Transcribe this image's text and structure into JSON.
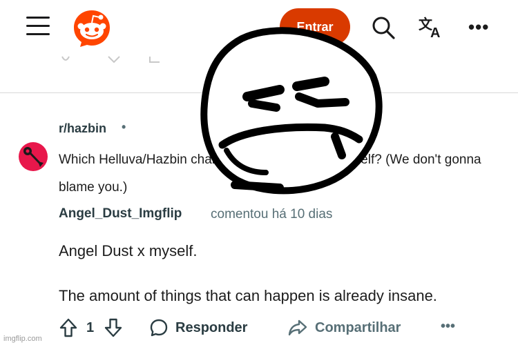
{
  "header": {
    "enter_label": "Entrar",
    "colors": {
      "brand": "#ff4500",
      "enter_button": "#d93a00"
    },
    "icons": [
      "menu-icon",
      "reddit-logo",
      "search-icon",
      "translate-icon",
      "more-icon"
    ]
  },
  "post": {
    "subreddit": "r/hazbin",
    "separator": "•",
    "title": "Which Helluva/Hazbin character you ship with yourself? (We don't gonna blame you.)"
  },
  "comment": {
    "author": "Angel_Dust_Imgflip",
    "meta": "comentou há 10 dias",
    "line1": "Angel Dust x myself.",
    "line2": "The amount of things that can happen is already insane."
  },
  "actions": {
    "vote_count": "1",
    "reply_label": "Responder",
    "share_label": "Compartilhar",
    "more_label": "•••"
  },
  "watermark": "imgflip.com"
}
